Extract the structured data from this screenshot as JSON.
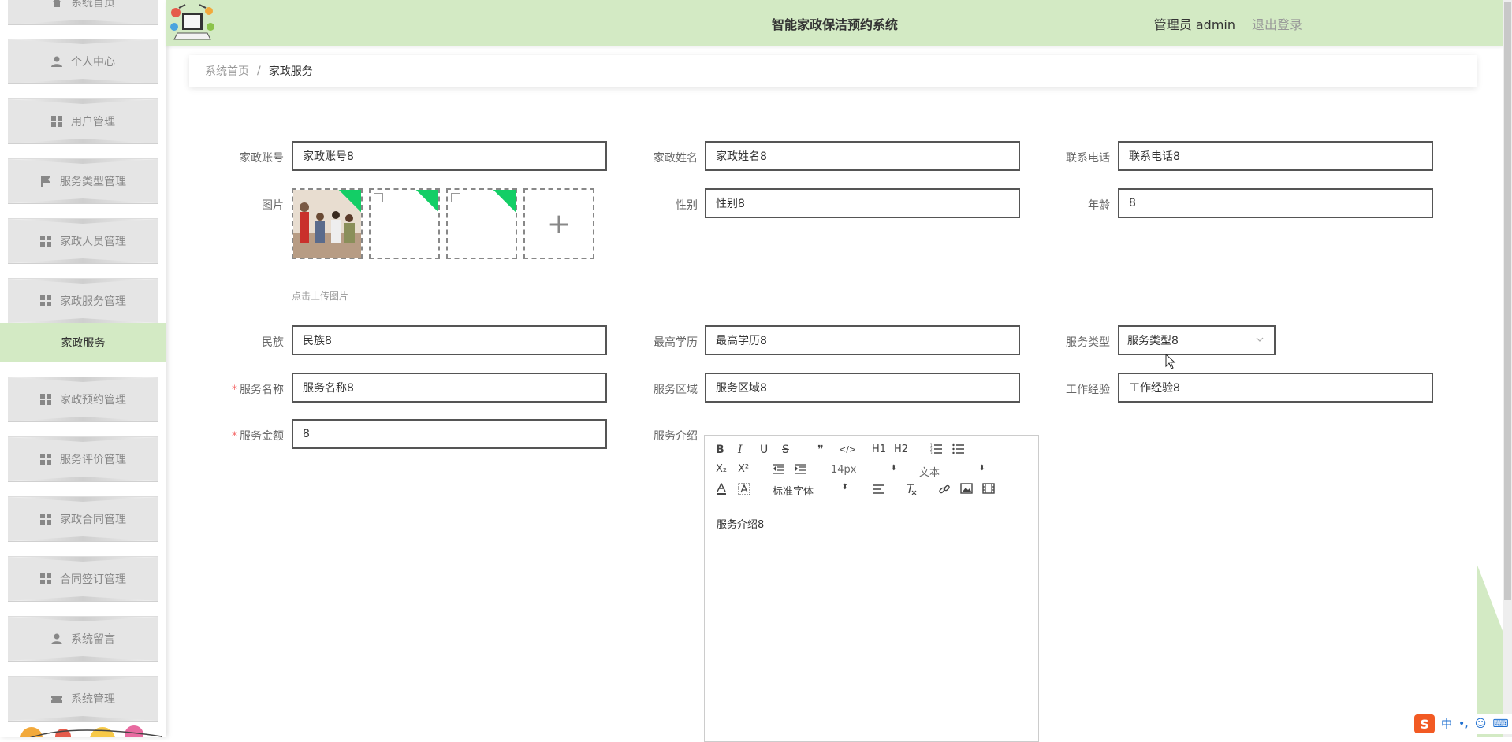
{
  "header": {
    "title": "智能家政保洁预约系统",
    "user": "管理员 admin",
    "logout": "退出登录"
  },
  "sidebar": {
    "items": [
      {
        "label": "系统首页",
        "icon": "home-icon"
      },
      {
        "label": "个人中心",
        "icon": "user-icon"
      },
      {
        "label": "用户管理",
        "icon": "grid-icon"
      },
      {
        "label": "服务类型管理",
        "icon": "flag-icon"
      },
      {
        "label": "家政人员管理",
        "icon": "grid-icon"
      },
      {
        "label": "家政服务管理",
        "icon": "grid-icon"
      },
      {
        "label": "家政预约管理",
        "icon": "grid-icon"
      },
      {
        "label": "服务评价管理",
        "icon": "grid-icon"
      },
      {
        "label": "家政合同管理",
        "icon": "grid-icon"
      },
      {
        "label": "合同签订管理",
        "icon": "grid-icon"
      },
      {
        "label": "系统留言",
        "icon": "user-icon"
      },
      {
        "label": "系统管理",
        "icon": "ticket-icon"
      }
    ],
    "sub_item": "家政服务"
  },
  "breadcrumb": {
    "home": "系统首页",
    "separator": "/",
    "current": "家政服务"
  },
  "form": {
    "account": {
      "label": "家政账号",
      "value": "家政账号8"
    },
    "name": {
      "label": "家政姓名",
      "value": "家政姓名8"
    },
    "phone": {
      "label": "联系电话",
      "value": "联系电话8"
    },
    "image": {
      "label": "图片",
      "upload_tip": "点击上传图片"
    },
    "gender": {
      "label": "性别",
      "value": "性别8"
    },
    "age": {
      "label": "年龄",
      "value": "8"
    },
    "ethnicity": {
      "label": "民族",
      "value": "民族8"
    },
    "education": {
      "label": "最高学历",
      "value": "最高学历8"
    },
    "service_type": {
      "label": "服务类型",
      "value": "服务类型8"
    },
    "service_name": {
      "label": "服务名称",
      "value": "服务名称8",
      "required": "*"
    },
    "service_area": {
      "label": "服务区域",
      "value": "服务区域8"
    },
    "experience": {
      "label": "工作经验",
      "value": "工作经验8"
    },
    "service_amount": {
      "label": "服务金额",
      "value": "8",
      "required": "*"
    },
    "intro": {
      "label": "服务介绍",
      "content": "服务介绍8"
    }
  },
  "editor": {
    "font_size": "14px",
    "text_style": "文本",
    "font_family": "标准字体",
    "buttons": {
      "bold": "B",
      "italic": "I",
      "underline": "U",
      "strike": "S",
      "quote": "❞",
      "code": "</>",
      "h1": "H1",
      "h2": "H2",
      "sub": "X₂",
      "sup": "X²"
    }
  },
  "ime": {
    "lang": "中",
    "punct": "•,",
    "emoji": "☺",
    "keyboard": "⌨"
  },
  "colors": {
    "header_bg": "#d3eac4",
    "sidebar_active": "#d3eac4",
    "required": "#f56c6c",
    "upload_badge": "#13ce66"
  }
}
